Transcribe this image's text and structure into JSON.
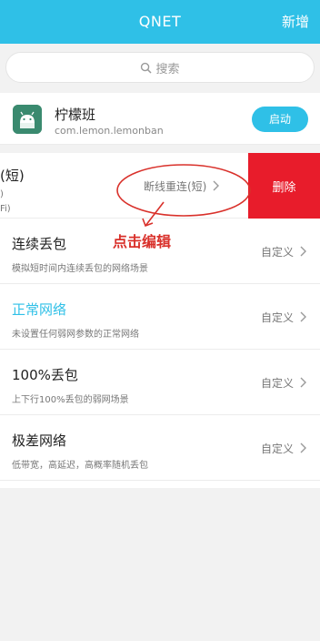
{
  "header": {
    "title": "QNET",
    "action": "新增"
  },
  "search": {
    "placeholder": "搜索"
  },
  "app": {
    "name": "柠檬班",
    "package": "com.lemon.lemonban",
    "launch_label": "启动"
  },
  "swiped_row": {
    "title": "(短)",
    "desc_line1": ")",
    "desc_line2": "Fi)",
    "action_label": "断线重连(短)",
    "delete_label": "删除"
  },
  "annotation": {
    "text": "点击编辑",
    "color": "#d9312b"
  },
  "rows": [
    {
      "title": "连续丢包",
      "desc": "模拟短时间内连续丢包的网络场景",
      "action": "自定义",
      "active": false
    },
    {
      "title": "正常网络",
      "desc": "未设置任何弱网参数的正常网络",
      "action": "自定义",
      "active": true
    },
    {
      "title": "100%丢包",
      "desc": "上下行100%丢包的弱网场景",
      "action": "自定义",
      "active": false
    },
    {
      "title": "极差网络",
      "desc": "低带宽，高延迟，高概率随机丢包",
      "action": "自定义",
      "active": false
    }
  ],
  "colors": {
    "accent": "#2fc0e7",
    "delete": "#e81c2b"
  },
  "icons": {
    "search": "search-icon",
    "app": "android-app-icon",
    "chevron": "chevron-right-icon"
  }
}
